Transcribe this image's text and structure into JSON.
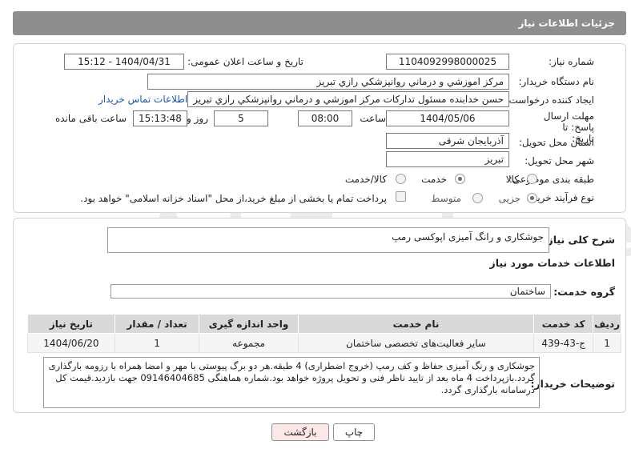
{
  "header": {
    "title": "جزئیات اطلاعات نیاز"
  },
  "form": {
    "need_number_label": "شماره نیاز:",
    "need_number": "1104092998000025",
    "announce_label": "تاریخ و ساعت اعلان عمومی:",
    "announce_value": "1404/04/31 - 15:12",
    "buyer_org_label": "نام دستگاه خریدار:",
    "buyer_org": "مرکز اموزشي و درماني روانپزشکي رازي تبريز",
    "creator_label": "ایجاد کننده درخواست:",
    "creator": "حسن خدابنده مسئول تدارکات مرکز اموزشي و درماني روانپزشکي رازي تبريز",
    "contact_link": "اطلاعات تماس خریدار",
    "deadline_label": "مهلت ارسال پاسخ: تا تاریخ:",
    "deadline_date": "1404/05/06",
    "hour_label": "ساعت",
    "deadline_time": "08:00",
    "days_value": "5",
    "days_label": "روز و",
    "remaining_time": "15:13:48",
    "remaining_label": "ساعت باقی مانده",
    "province_label": "استان محل تحویل:",
    "province": "آذربایجان شرقی",
    "city_label": "شهر محل تحویل:",
    "city": "تبریز",
    "category_label": "طبقه بندی موضوعی:",
    "category_options": [
      "کالا",
      "خدمت",
      "کالا/خدمت"
    ],
    "category_selected": "خدمت",
    "purchase_label": "نوع فرآیند خرید :",
    "purchase_options": [
      "جزیی",
      "متوسط"
    ],
    "purchase_selected": "جزیی",
    "payment_note": "پرداخت تمام یا بخشی از مبلغ خرید،از محل \"اسناد خزانه اسلامی\" خواهد بود."
  },
  "summary": {
    "label": "شرح کلی نیاز:",
    "value": "جوشکاری و رانگ آمیزی اپوکسی رمپ"
  },
  "services": {
    "section_title": "اطلاعات خدمات مورد نیاز",
    "group_label": "گروه خدمت:",
    "group_value": "ساختمان",
    "columns": [
      "ردیف",
      "کد خدمت",
      "نام خدمت",
      "واحد اندازه گیری",
      "تعداد / مقدار",
      "تاریخ نیاز"
    ],
    "rows": [
      [
        "1",
        "ج-43-439",
        "سایر فعالیت‌های تخصصی ساختمان",
        "مجموعه",
        "1",
        "1404/06/20"
      ]
    ]
  },
  "notes": {
    "label": "توضیحات خریدار:",
    "value": "جوشکاری و رنگ آمیزی حفاظ و کف رمپ (خروج اضطراری) 4 طبقه.هر دو برگ پیوستی با مهر و امضا همراه با رزومه بارگذاری گردد.بازپرداخت 4 ماه بعد از تایید ناظر فنی و تحویل پروژه خواهد بود.شمارە هماهنگی 09146404685 جهت بازدید.قیمت کل درسامانه بارگذاری گردد."
  },
  "buttons": {
    "print": "چاپ",
    "back": "بازگشت"
  },
  "watermark": "AriaTender.net",
  "colors": {
    "header_bg": "#8e8e8e",
    "link": "#1a57b2",
    "back_button_bg": "#fde8e8",
    "table_header_bg": "#d9d9d9"
  }
}
